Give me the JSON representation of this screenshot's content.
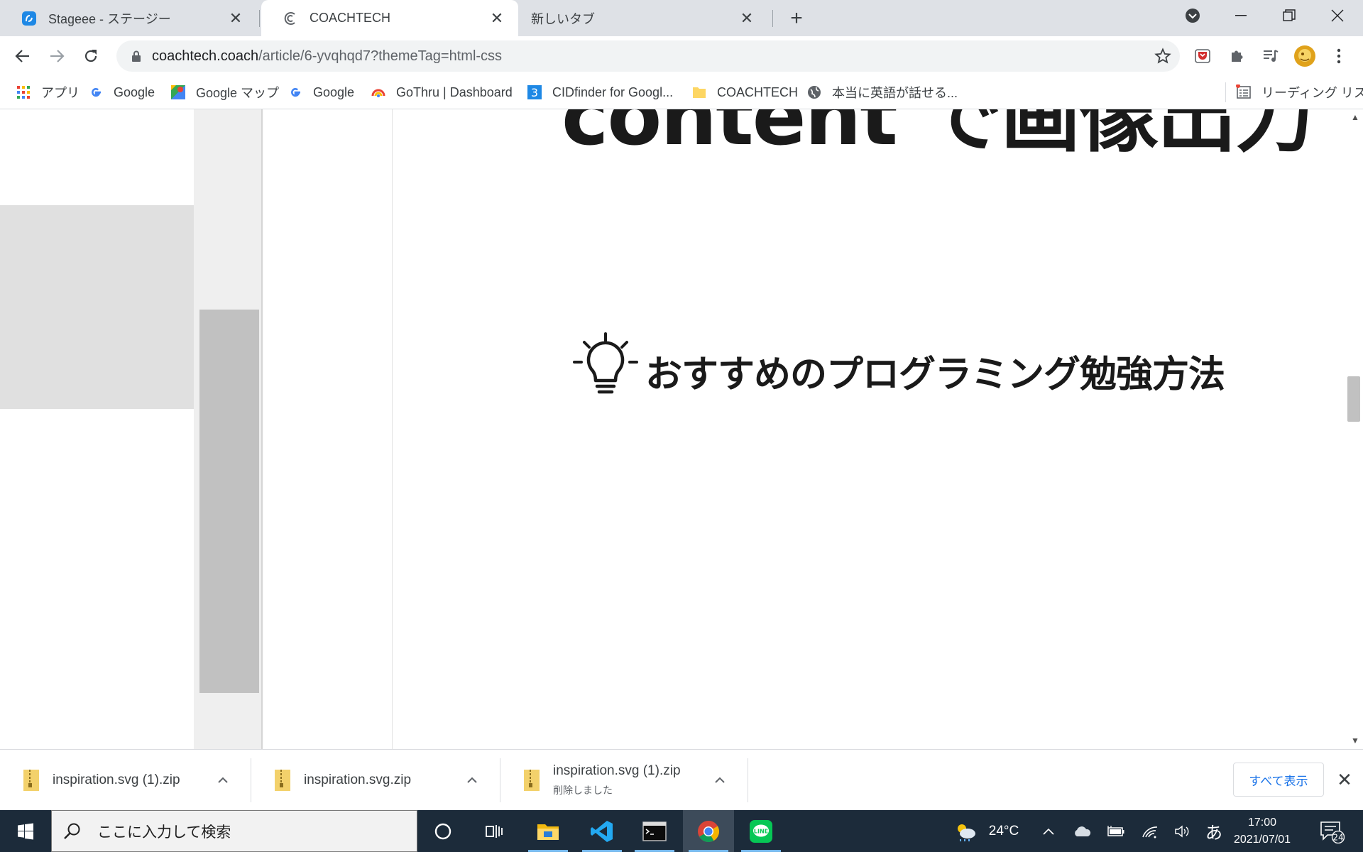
{
  "tabs": [
    {
      "title": "Stageee - ステージー",
      "active": false
    },
    {
      "title": "COACHTECH",
      "active": true
    },
    {
      "title": "新しいタブ",
      "active": false
    }
  ],
  "omnibox": {
    "host": "coachtech.coach",
    "path": "/article/6-yvqhqd7?themeTag=html-css"
  },
  "bookmarks": [
    {
      "label": "アプリ",
      "icon": "apps-grid-icon"
    },
    {
      "label": "Google",
      "icon": "google-icon"
    },
    {
      "label": "Google マップ",
      "icon": "google-maps-icon"
    },
    {
      "label": "Google",
      "icon": "google-icon"
    },
    {
      "label": "GoThru | Dashboard",
      "icon": "gothru-icon"
    },
    {
      "label": "CIDfinder for Googl...",
      "icon": "cidfinder-icon"
    },
    {
      "label": "COACHTECH",
      "icon": "folder-icon"
    },
    {
      "label": "本当に英語が話せる...",
      "icon": "globe-icon"
    }
  ],
  "reading_list": "リーディング リスト",
  "article": {
    "headline_partial": "content で画像出力",
    "recommend_heading": "おすすめのプログラミング勉強方法"
  },
  "downloads": [
    {
      "name": "inspiration.svg (1).zip",
      "status": ""
    },
    {
      "name": "inspiration.svg.zip",
      "status": ""
    },
    {
      "name": "inspiration.svg (1).zip",
      "status": "削除しました"
    }
  ],
  "download_shelf": {
    "show_all": "すべて表示"
  },
  "taskbar": {
    "search_placeholder": "ここに入力して検索",
    "weather": "24°C",
    "ime": "あ",
    "time": "17:00",
    "date": "2021/07/01",
    "notifications": "24"
  },
  "colors": {
    "taskbar": "#1c2b3a",
    "accent": "#1a73e8",
    "headline": "#1a1a1a"
  }
}
